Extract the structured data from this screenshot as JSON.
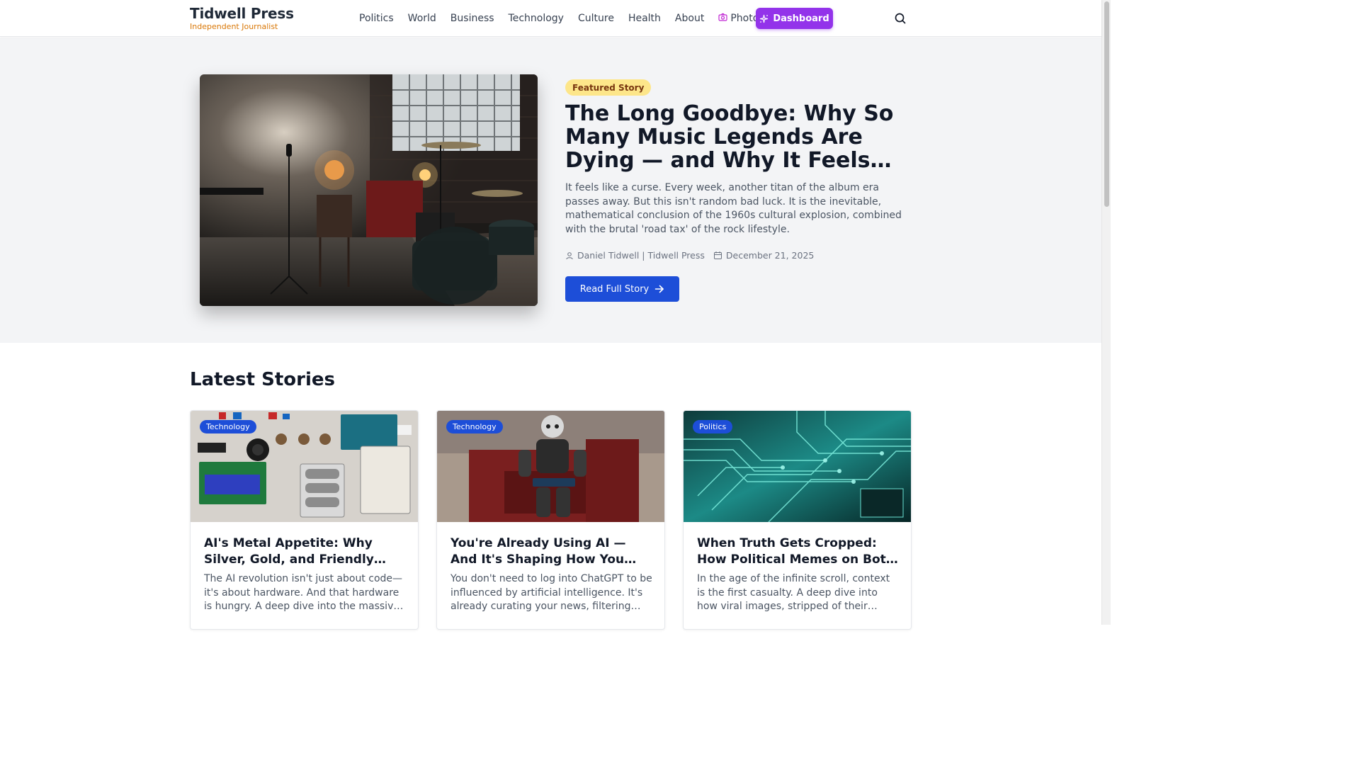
{
  "header": {
    "brand_title": "Tidwell Press",
    "brand_subtitle": "Independent Journalist",
    "nav": [
      "Politics",
      "World",
      "Business",
      "Technology",
      "Culture",
      "Health",
      "About"
    ],
    "photos_label": "Photos",
    "dashboard_label": "Dashboard",
    "icons": {
      "photos": "camera-icon",
      "dashboard": "sparkles-icon",
      "search": "search-icon"
    }
  },
  "hero": {
    "badge": "Featured Story",
    "title": "The Long Goodbye: Why So Many Music Legends Are Dying — and Why It Feels Like a Curse",
    "excerpt": "It feels like a curse. Every week, another titan of the album era passes away. But this isn't random bad luck. It is the inevitable, mathematical conclusion of the 1960s cultural explosion, combined with the brutal 'road tax' of the rock lifestyle.",
    "author": "Daniel Tidwell | Tidwell Press",
    "date": "December 21, 2025",
    "button_label": "Read Full Story",
    "image": "stage-drums-photo"
  },
  "latest": {
    "title": "Latest Stories",
    "cards": [
      {
        "category": "Technology",
        "title": "AI's Metal Appetite: Why Silver, Gold, and Friendly Metals Matter",
        "excerpt": "The AI revolution isn't just about code—it's about hardware. And that hardware is hungry. A deep dive into the massive demand for metals.",
        "image": "electronics-kit-photo"
      },
      {
        "category": "Technology",
        "title": "You're Already Using AI — And It's Shaping How You Think",
        "excerpt": "You don't need to log into ChatGPT to be influenced by artificial intelligence. It's already curating your news, filtering your feeds.",
        "image": "robot-photo"
      },
      {
        "category": "Politics",
        "title": "When Truth Gets Cropped: How Political Memes on Both Sides Mislead",
        "excerpt": "In the age of the infinite scroll, context is the first casualty. A deep dive into how viral images, stripped of their original context.",
        "image": "circuit-board-photo"
      }
    ]
  },
  "colors": {
    "accent_blue": "#1d4ed8",
    "dashboard_purple": "#9333ea",
    "brand_orange": "#d97706",
    "featured_badge": "#fde68a"
  }
}
